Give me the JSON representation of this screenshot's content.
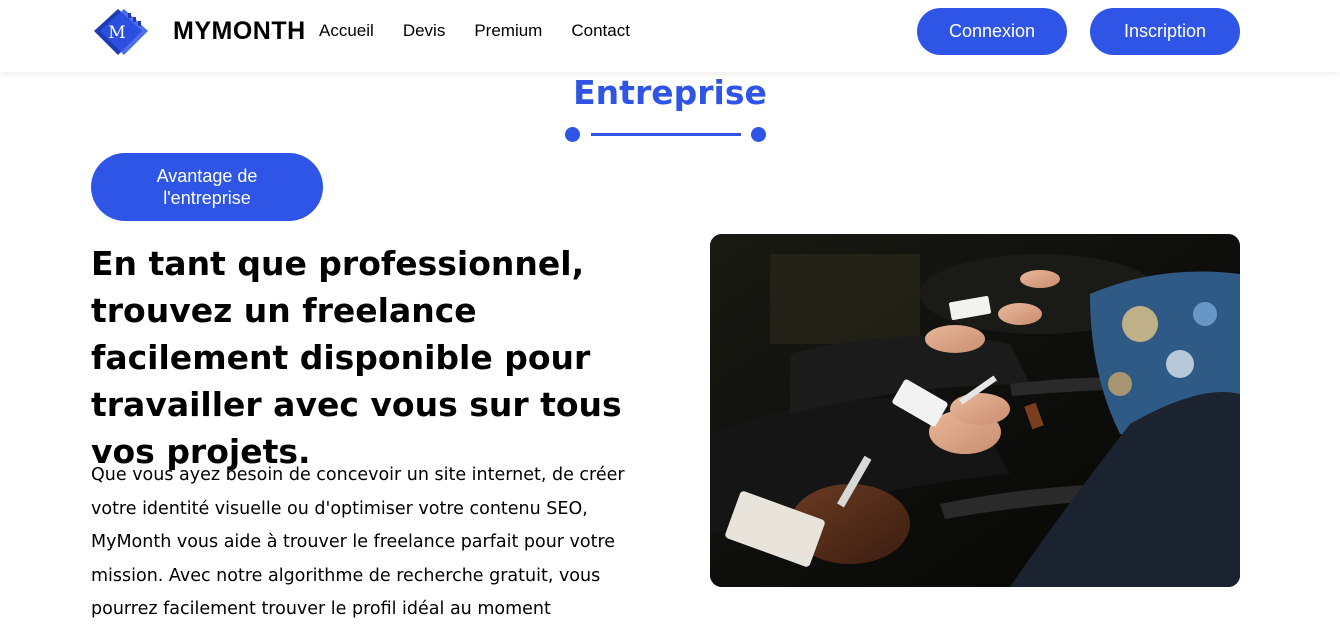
{
  "header": {
    "brand": "MYMONTH",
    "logo_letter": "M",
    "nav": [
      "Accueil",
      "Devis",
      "Premium",
      "Contact"
    ],
    "login_label": "Connexion",
    "signup_label": "Inscription"
  },
  "section": {
    "title": "Entreprise",
    "tag_label": "Avantage de l'entreprise",
    "headline": "En tant que professionnel, trouvez un freelance facilement disponible pour travailler avec vous sur tous vos projets.",
    "body": "Que vous ayez besoin de concevoir un site internet, de créer votre identité visuelle ou d'optimiser votre contenu SEO, MyMonth vous aide à trouver le freelance parfait pour votre mission. Avec notre algorithme de recherche gratuit, vous pourrez facilement trouver le profil idéal au moment"
  },
  "colors": {
    "accent": "#2e55e6",
    "text": "#000000",
    "background": "#ffffff"
  },
  "icons": {
    "logo": "mymonth-logo-icon"
  }
}
